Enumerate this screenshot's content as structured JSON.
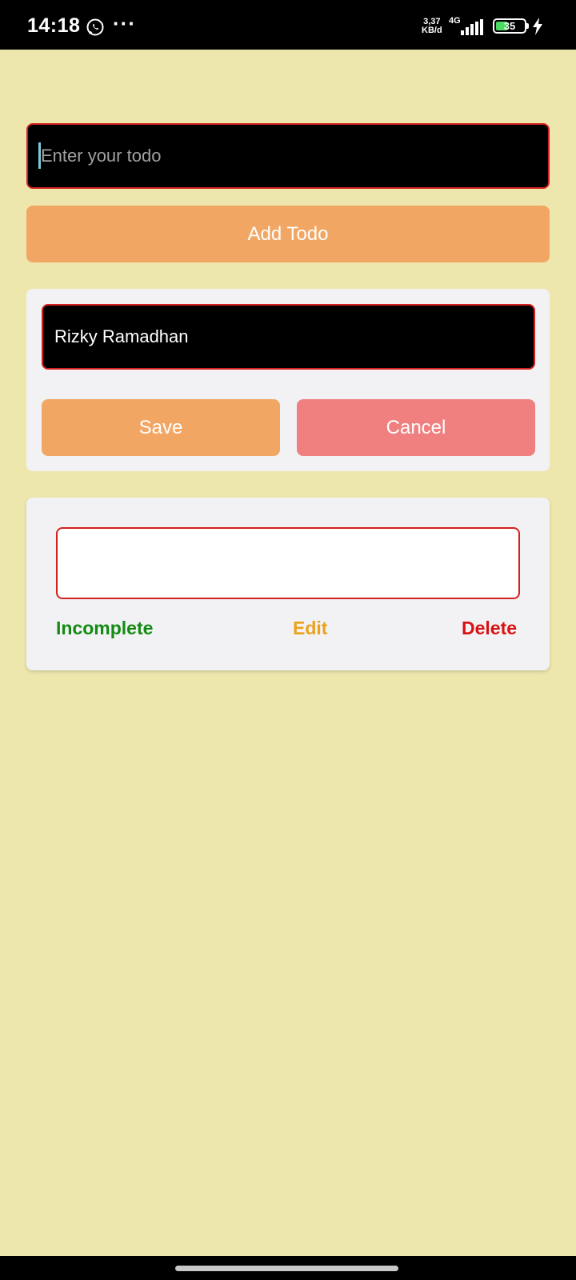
{
  "status_bar": {
    "time": "14:18",
    "more": "···",
    "net_speed_value": "3,37",
    "net_speed_unit": "KB/d",
    "network_type": "4G",
    "battery_level": "35",
    "icons": [
      "whatsapp-icon",
      "signal-icon",
      "battery-icon",
      "charging-icon"
    ]
  },
  "todo_form": {
    "placeholder": "Enter your todo",
    "value": "",
    "add_label": "Add Todo"
  },
  "edit_form": {
    "value": "Rizky Ramadhan",
    "save_label": "Save",
    "cancel_label": "Cancel"
  },
  "todo_item": {
    "text": "",
    "incomplete_label": "Incomplete",
    "edit_label": "Edit",
    "delete_label": "Delete"
  },
  "colors": {
    "background": "#ede7ae",
    "accent_orange": "#f2a663",
    "cancel_pink": "#f08080",
    "border_red": "#d32020",
    "incomplete_green": "#138a13",
    "edit_yellow": "#eaa21c",
    "delete_red": "#d81212"
  }
}
